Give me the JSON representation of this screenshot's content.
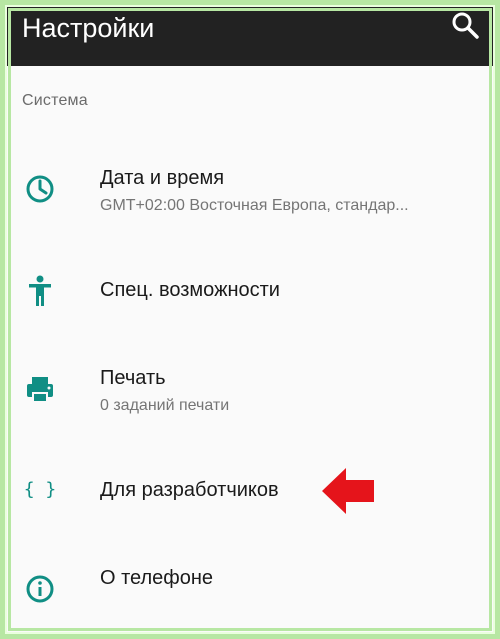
{
  "app_bar": {
    "title": "Настройки",
    "search_icon": "search-icon"
  },
  "section": {
    "header": "Система"
  },
  "items": [
    {
      "icon": "clock-icon",
      "title": "Дата и время",
      "subtitle": "GMT+02:00 Восточная Европа, стандар..."
    },
    {
      "icon": "accessibility-icon",
      "title": "Спец. возможности",
      "subtitle": ""
    },
    {
      "icon": "printer-icon",
      "title": "Печать",
      "subtitle": "0 заданий печати"
    },
    {
      "icon": "developer-braces-icon",
      "icon_glyph": "{ }",
      "title": "Для разработчиков",
      "subtitle": ""
    },
    {
      "icon": "info-icon",
      "title": "О телефоне",
      "subtitle": ""
    }
  ],
  "colors": {
    "accent": "#108e84",
    "app_bar_bg": "#222222",
    "background": "#fafafa",
    "annotation_arrow": "#e5141b",
    "frame": "#b7e7a3"
  }
}
